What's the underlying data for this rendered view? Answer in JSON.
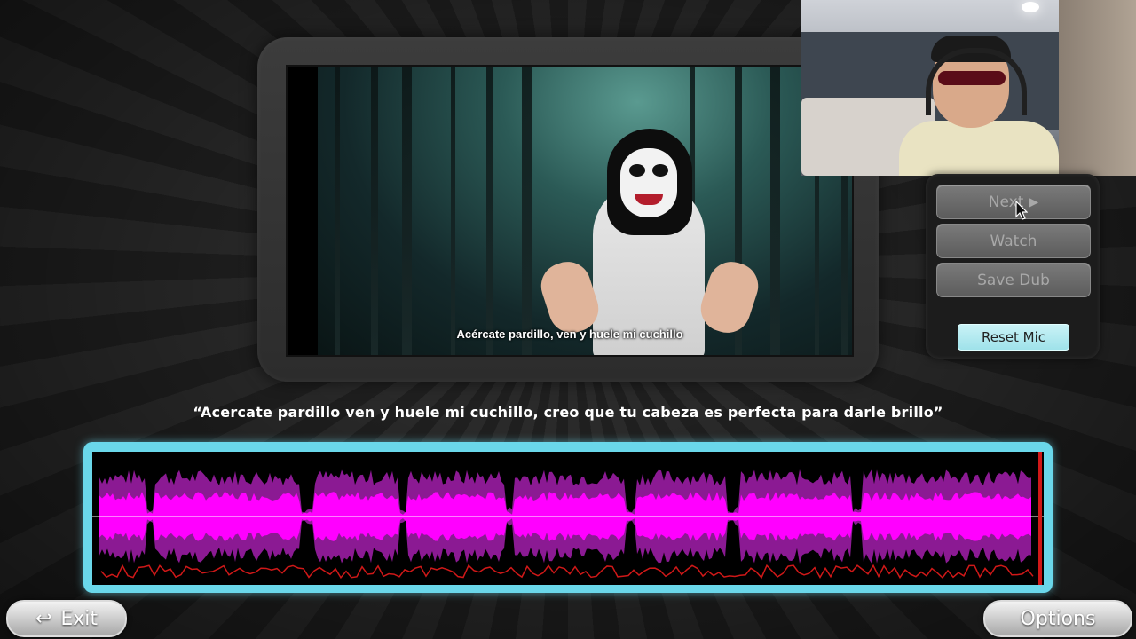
{
  "video": {
    "subtitle": "Acércate pardillo, ven y huele mi cuchillo"
  },
  "panel": {
    "next_label": "Next",
    "next_icon": "play-triangle-icon",
    "watch_label": "Watch",
    "save_label": "Save Dub",
    "reset_label": "Reset Mic"
  },
  "line_text": "“Acercate pardillo ven y huele mi cuchillo, creo que tu cabeza es perfecta para darle brillo”",
  "footer": {
    "exit_label": "Exit",
    "exit_icon": "return-arrow-icon",
    "options_label": "Options"
  },
  "colors": {
    "wave_outer": "#8b1a93",
    "wave_inner": "#ff00ff",
    "frame": "#6ad7ea",
    "mic_trace": "#d01818",
    "playhead": "#d01818"
  }
}
